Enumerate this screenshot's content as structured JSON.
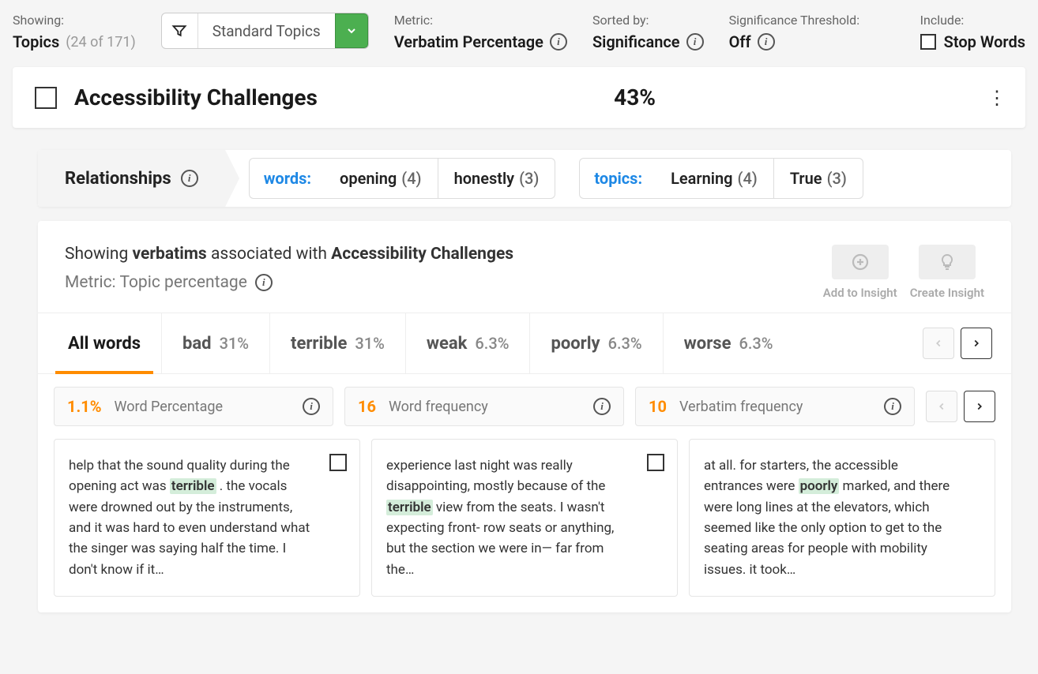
{
  "toolbar": {
    "showing_label": "Showing:",
    "showing_value": "Topics",
    "showing_count": "(24 of 171)",
    "filter_value": "Standard Topics",
    "metric_label": "Metric:",
    "metric_value": "Verbatim Percentage",
    "sorted_label": "Sorted by:",
    "sorted_value": "Significance",
    "sig_label": "Significance Threshold:",
    "sig_value": "Off",
    "include_label": "Include:",
    "include_value": "Stop Words"
  },
  "topic": {
    "title": "Accessibility Challenges",
    "pct": "43%"
  },
  "relationships": {
    "tab": "Relationships",
    "words_label": "words:",
    "words": [
      {
        "label": "opening",
        "count": "(4)"
      },
      {
        "label": "honestly",
        "count": "(3)"
      }
    ],
    "topics_label": "topics:",
    "topics": [
      {
        "label": "Learning",
        "count": "(4)"
      },
      {
        "label": "True",
        "count": "(3)"
      }
    ]
  },
  "verbatims": {
    "header_prefix": "Showing ",
    "header_bold1": "verbatims",
    "header_mid": " associated with ",
    "header_bold2": "Accessibility Challenges",
    "metric_line": "Metric: Topic percentage",
    "add_insight": "Add to Insight",
    "create_insight": "Create Insight"
  },
  "word_tabs": [
    {
      "label": "All words",
      "pct": ""
    },
    {
      "label": "bad",
      "pct": "31%"
    },
    {
      "label": "terrible",
      "pct": "31%"
    },
    {
      "label": "weak",
      "pct": "6.3%"
    },
    {
      "label": "poorly",
      "pct": "6.3%"
    },
    {
      "label": "worse",
      "pct": "6.3%"
    }
  ],
  "stats": [
    {
      "value": "1.1%",
      "label": "Word Percentage"
    },
    {
      "value": "16",
      "label": "Word frequency"
    },
    {
      "value": "10",
      "label": "Verbatim frequency"
    }
  ],
  "cards": [
    {
      "pre": "help that the sound quality during the opening act was ",
      "hl": "terrible",
      "post": " . the vocals were drowned out by the instruments, and it was hard to even understand what the singer was saying half the time. I don't know if it…"
    },
    {
      "pre": "experience last night was really disappointing, mostly because of the ",
      "hl": "terrible",
      "post": " view from the seats. I wasn't expecting front- row seats or anything, but the section we were in— far from the…"
    },
    {
      "pre": "at all. for starters, the accessible entrances were ",
      "hl": "poorly",
      "post": " marked, and there were long lines at the elevators, which seemed like the only option to get to the seating areas for people with mobility issues. it took…"
    }
  ],
  "colors": {
    "accent_orange": "#ff8c00",
    "accent_blue": "#1e88e5",
    "accent_green": "#4caf50"
  }
}
